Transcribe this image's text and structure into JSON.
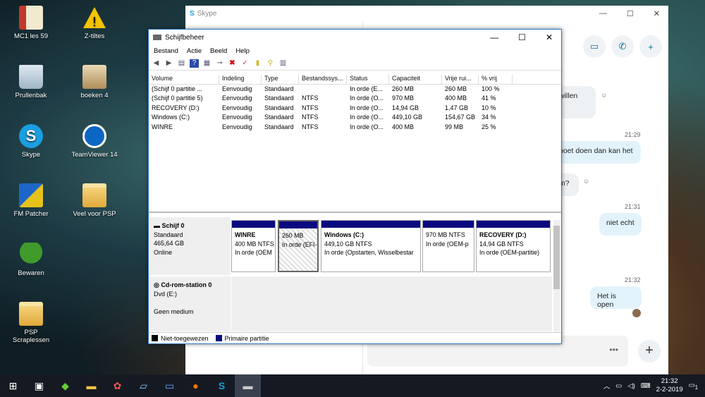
{
  "desktop_icons": [
    {
      "label": "MC1 les 59",
      "x": "",
      "kind": "book"
    },
    {
      "label": "Z-tiltes"
    },
    {
      "label": "Prullenbak"
    },
    {
      "label": "boeken 4"
    },
    {
      "label": "Skype"
    },
    {
      "label": "TeamViewer 14"
    },
    {
      "label": "FM Patcher"
    },
    {
      "label": "Veel voor PSP"
    },
    {
      "label": "Bewaren"
    },
    {
      "label": "PSP Scraplessen"
    }
  ],
  "skype": {
    "title": "Skype",
    "messages": [
      {
        "text": "willen",
        "type": "other"
      },
      {
        "time": "21:29"
      },
      {
        "text": "noet doen dan kan het",
        "type": "me"
      },
      {
        "text": "m?",
        "type": "other"
      },
      {
        "time": "21:31"
      },
      {
        "text": "niet echt",
        "type": "me"
      },
      {
        "time": "21:32"
      },
      {
        "text": "Het is open",
        "type": "me"
      }
    ],
    "input_more": "•••",
    "add": "+"
  },
  "dm": {
    "title": "Schijfbeheer",
    "menu": [
      "Bestand",
      "Actie",
      "Beeld",
      "Help"
    ],
    "columns": [
      "Volume",
      "Indeling",
      "Type",
      "Bestandssys...",
      "Status",
      "Capaciteit",
      "Vrije rui...",
      "% vrij"
    ],
    "rows": [
      [
        "(Schijf 0 partitie ...",
        "Eenvoudig",
        "Standaard",
        "",
        "In orde (E...",
        "260 MB",
        "260 MB",
        "100 %"
      ],
      [
        "(Schijf 0 partitie 5)",
        "Eenvoudig",
        "Standaard",
        "NTFS",
        "In orde (O...",
        "970 MB",
        "400 MB",
        "41 %"
      ],
      [
        "RECOVERY (D:)",
        "Eenvoudig",
        "Standaard",
        "NTFS",
        "In orde (O...",
        "14,94 GB",
        "1,47 GB",
        "10 %"
      ],
      [
        "Windows (C:)",
        "Eenvoudig",
        "Standaard",
        "NTFS",
        "In orde (O...",
        "449,10 GB",
        "154,67 GB",
        "34 %"
      ],
      [
        "WINRE",
        "Eenvoudig",
        "Standaard",
        "NTFS",
        "In orde (O...",
        "400 MB",
        "99 MB",
        "25 %"
      ]
    ],
    "disk0": {
      "name": "Schijf 0",
      "type": "Standaard",
      "size": "465,64 GB",
      "state": "Online"
    },
    "partitions": [
      {
        "name": "WINRE",
        "size": "400 MB NTFS",
        "status": "In orde (OEM"
      },
      {
        "name": "",
        "size": "260 MB",
        "status": "In orde (EFI-"
      },
      {
        "name": "Windows  (C:)",
        "size": "449,10 GB NTFS",
        "status": "In orde (Opstarten, Wisselbestar"
      },
      {
        "name": "",
        "size": "970 MB NTFS",
        "status": "In orde (OEM-p"
      },
      {
        "name": "RECOVERY  (D:)",
        "size": "14,94 GB NTFS",
        "status": "In orde (OEM-partitie)"
      }
    ],
    "cdrom": {
      "name": "Cd-rom-station 0",
      "type": "Dvd (E:)",
      "media": "Geen medium"
    },
    "legend": [
      "Niet-toegewezen",
      "Primaire partitie"
    ]
  },
  "taskbar": {
    "time": "21:32",
    "date": "2-2-2019",
    "notif": "1"
  }
}
